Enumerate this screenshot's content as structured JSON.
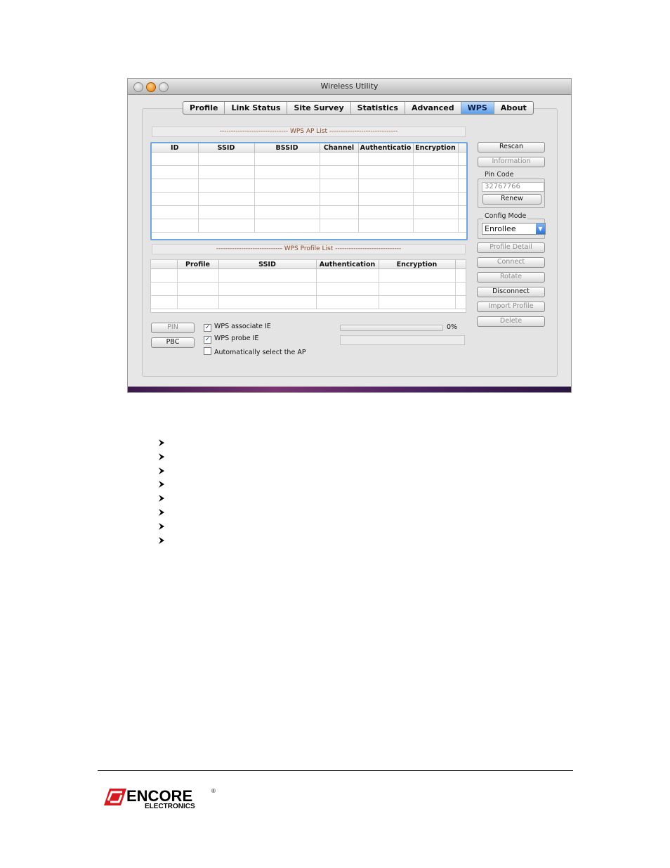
{
  "window": {
    "title": "Wireless Utility"
  },
  "tabs": [
    {
      "label": "Profile",
      "active": false
    },
    {
      "label": "Link Status",
      "active": false
    },
    {
      "label": "Site Survey",
      "active": false
    },
    {
      "label": "Statistics",
      "active": false
    },
    {
      "label": "Advanced",
      "active": false
    },
    {
      "label": "WPS",
      "active": true
    },
    {
      "label": "About",
      "active": false
    }
  ],
  "ap_list": {
    "header": "------------------------------ WPS AP List ------------------------------",
    "columns": [
      "ID",
      "SSID",
      "BSSID",
      "Channel",
      "Authenticatio",
      "Encryption"
    ],
    "rows": []
  },
  "profile_list": {
    "header": "----------------------------- WPS Profile List -----------------------------",
    "columns": [
      "",
      "Profile",
      "SSID",
      "Authentication",
      "Encryption"
    ],
    "rows": []
  },
  "buttons": {
    "rescan": "Rescan",
    "information": "Information",
    "renew": "Renew",
    "profile_detail": "Profile Detail",
    "connect": "Connect",
    "rotate": "Rotate",
    "disconnect": "Disconnect",
    "import_profile": "Import Profile",
    "delete": "Delete",
    "pin": "PIN",
    "pbc": "PBC"
  },
  "pin_code": {
    "label": "Pin Code",
    "value": "32767766"
  },
  "config_mode": {
    "label": "Config Mode",
    "selected": "Enrollee"
  },
  "checkboxes": [
    {
      "label": "WPS associate IE",
      "checked": true
    },
    {
      "label": "WPS probe IE",
      "checked": true
    },
    {
      "label": "Automatically select the AP",
      "checked": false
    }
  ],
  "progress": {
    "percent_label": "0%",
    "value": 0
  },
  "bullet_count": 8,
  "logo": {
    "text": "ENCORE",
    "subtext": "ELECTRONICS",
    "mark": "®",
    "brand_color": "#d71920"
  }
}
